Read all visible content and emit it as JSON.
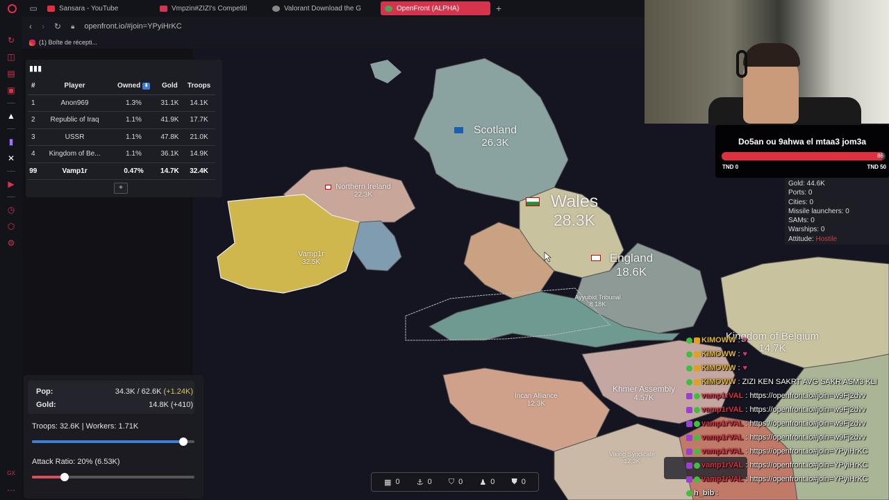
{
  "browser": {
    "tabs": [
      {
        "title": "Sansara - YouTube",
        "color": "#e0303f"
      },
      {
        "title": "Vmpzin#ZIZI's Competiti",
        "color": "#d6334c"
      },
      {
        "title": "Valorant Download the G",
        "color": "#888888"
      },
      {
        "title": "OpenFront (ALPHA)",
        "color": "#4aa45a"
      }
    ],
    "url": "openfront.io/#join=YPyiHrKC",
    "bookmark": "(1) Boîte de récepti..."
  },
  "leaderboard": {
    "headers": [
      "#",
      "Player",
      "Owned",
      "Gold",
      "Troops"
    ],
    "sort_icon": "arrow-down-icon",
    "rows": [
      {
        "rank": "1",
        "player": "Anon969",
        "owned": "1.3%",
        "gold": "31.1K",
        "troops": "14.1K"
      },
      {
        "rank": "2",
        "player": "Republic of Iraq",
        "owned": "1.1%",
        "gold": "41.9K",
        "troops": "17.7K"
      },
      {
        "rank": "3",
        "player": "USSR",
        "owned": "1.1%",
        "gold": "47.8K",
        "troops": "21.0K"
      },
      {
        "rank": "4",
        "player": "Kingdom of Be...",
        "owned": "1.1%",
        "gold": "36.1K",
        "troops": "14.9K"
      },
      {
        "rank": "99",
        "player": "Vamp1r",
        "owned": "0.47%",
        "gold": "14.7K",
        "troops": "32.4K"
      }
    ],
    "more_label": "+"
  },
  "map_labels": [
    {
      "name": "Scotland",
      "troops": "26.3K"
    },
    {
      "name": "Northern Ireland",
      "troops": "22.3K"
    },
    {
      "name": "Wales",
      "troops": "28.3K"
    },
    {
      "name": "England",
      "troops": "18.6K"
    },
    {
      "name": "Vamp1r",
      "troops": "32.5K"
    },
    {
      "name": "Ayyubid Tribunal",
      "troops": "8.18K"
    },
    {
      "name": "Kingdom of Belgium",
      "troops": "14.7K"
    },
    {
      "name": "Khmer Assembly",
      "troops": "4.57K"
    },
    {
      "name": "Incan Alliance",
      "troops": "12.3K"
    },
    {
      "name": "Viking Syndicate",
      "troops": "12.3K"
    }
  ],
  "control_panel": {
    "pop_label": "Pop:",
    "pop_value": "34.3K / 62.6K",
    "pop_delta": "(+1.24K)",
    "gold_label": "Gold:",
    "gold_value": "14.8K (+410)",
    "troops_text": "Troops: 32.6K | Workers: 1.71K",
    "troops_ratio": 0.93,
    "attack_text": "Attack Ratio: 20% (6.53K)",
    "attack_ratio": 0.2,
    "troops_color": "#3f7fd6",
    "attack_color": "#d9505a"
  },
  "build_bar": [
    {
      "icon": "city-icon",
      "count": "0"
    },
    {
      "icon": "anchor-icon",
      "count": "0"
    },
    {
      "icon": "shield-icon",
      "count": "0"
    },
    {
      "icon": "missile-silo-icon",
      "count": "0"
    },
    {
      "icon": "sam-shield-icon",
      "count": "0"
    }
  ],
  "poll": {
    "title": "Do5an ou 9ahwa el mtaa3 jom3a",
    "value": "86",
    "fill_fraction": 0.98,
    "left_label": "TND 0",
    "right_label": "TND 50"
  },
  "player_info": {
    "gold": "Gold: 44.6K",
    "ports": "Ports: 0",
    "cities": "Cities: 0",
    "missiles": "Missile launchers: 0",
    "sams": "SAMs: 0",
    "warships": "Warships: 0",
    "attitude_label": "Attitude:",
    "attitude_value": "Hostile"
  },
  "chat": [
    {
      "user": "KIMOWW",
      "msg": " :",
      "heart": "♥",
      "type": "kimo"
    },
    {
      "user": "KIMOWW",
      "msg": " :",
      "heart": "♥",
      "type": "kimo"
    },
    {
      "user": "KIMOWW",
      "msg": " :",
      "heart": "♥",
      "type": "kimo"
    },
    {
      "user": "KIMOWW",
      "msg": ": ZIZI KEN SAKRT AVG SAKR ASM3 KLI",
      "heart": "",
      "type": "kimo"
    },
    {
      "user": "vamp1rVAL",
      "msg": ": https://openfront.io#join=w9Fj2dvv",
      "heart": "",
      "type": "vamp"
    },
    {
      "user": "vamp1rVAL",
      "msg": ": https://openfront.io#join=w9Fj2dvv",
      "heart": "",
      "type": "vamp"
    },
    {
      "user": "vamp1rVAL",
      "msg": ": https://openfront.io#join=w9Fj2dvv",
      "heart": "",
      "type": "vamp"
    },
    {
      "user": "vamp1rVAL",
      "msg": ": https://openfront.io#join=w9Fj2dvv",
      "heart": "",
      "type": "vamp"
    },
    {
      "user": "vamp1rVAL",
      "msg": ": https://openfront.io#join=YPyiHrKC",
      "heart": "",
      "type": "vamp"
    },
    {
      "user": "vamp1rVAL",
      "msg": ": https://openfront.io#join=YPyiHrKC",
      "heart": "",
      "type": "vamp"
    },
    {
      "user": "vamp1rVAL",
      "msg": ": https://openfront.io#join=YPyiHrKC",
      "heart": "",
      "type": "vamp"
    },
    {
      "user": "h_bib",
      "msg": ":",
      "heart": "",
      "type": "bib"
    }
  ]
}
